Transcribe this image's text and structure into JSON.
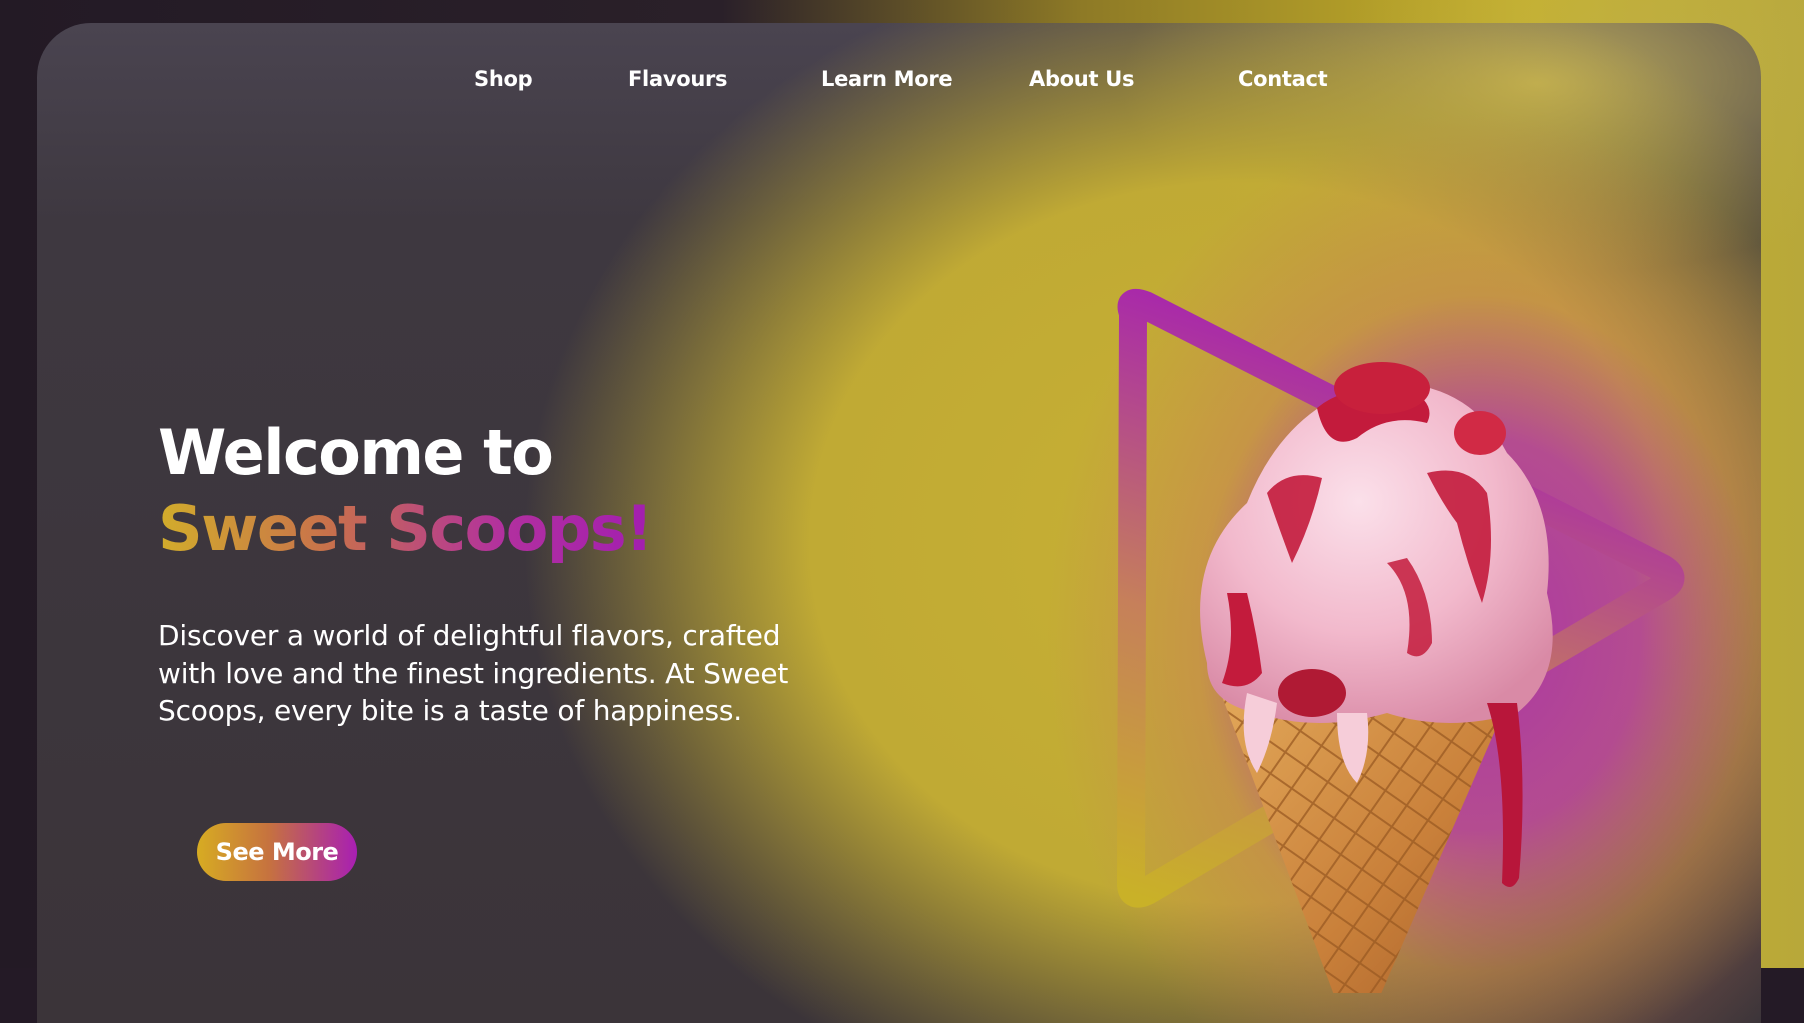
{
  "nav": {
    "items": [
      {
        "label": "Shop"
      },
      {
        "label": "Flavours"
      },
      {
        "label": "Learn More"
      },
      {
        "label": "About Us"
      },
      {
        "label": "Contact"
      }
    ]
  },
  "hero": {
    "title_line1": "Welcome to",
    "title_line2": "Sweet Scoops!",
    "description": "Discover a world of delightful flavors, crafted with love and the finest ingredients. At Sweet Scoops, every bite is a taste of happiness.",
    "cta_label": "See More"
  },
  "colors": {
    "page_bg": "#241a26",
    "card_dark": "#3b3439",
    "accent_yellow": "#c7b034",
    "accent_purple": "#a81fb3",
    "text": "#ffffff"
  },
  "icons": {
    "play_triangle": "play-triangle-icon",
    "hero_image": "ice-cream-cone-image"
  }
}
